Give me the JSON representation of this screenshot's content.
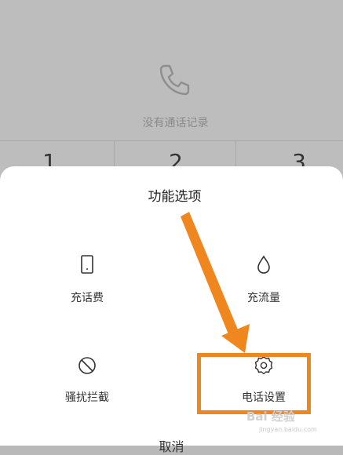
{
  "call_log": {
    "empty_text": "没有通话记录"
  },
  "dialpad": {
    "keys": [
      "1",
      "2",
      "3"
    ]
  },
  "sheet": {
    "title": "功能选项",
    "options": [
      {
        "label": "充话费",
        "icon": "phone-bill-icon"
      },
      {
        "label": "充流量",
        "icon": "water-drop-icon"
      },
      {
        "label": "骚扰拦截",
        "icon": "block-icon"
      },
      {
        "label": "电话设置",
        "icon": "gear-icon"
      }
    ],
    "cancel_label": "取消"
  },
  "annotation": {
    "color": "#f0861e"
  },
  "watermark": {
    "text": "Bai 经验",
    "sub": "jingyan.baidu.com"
  }
}
